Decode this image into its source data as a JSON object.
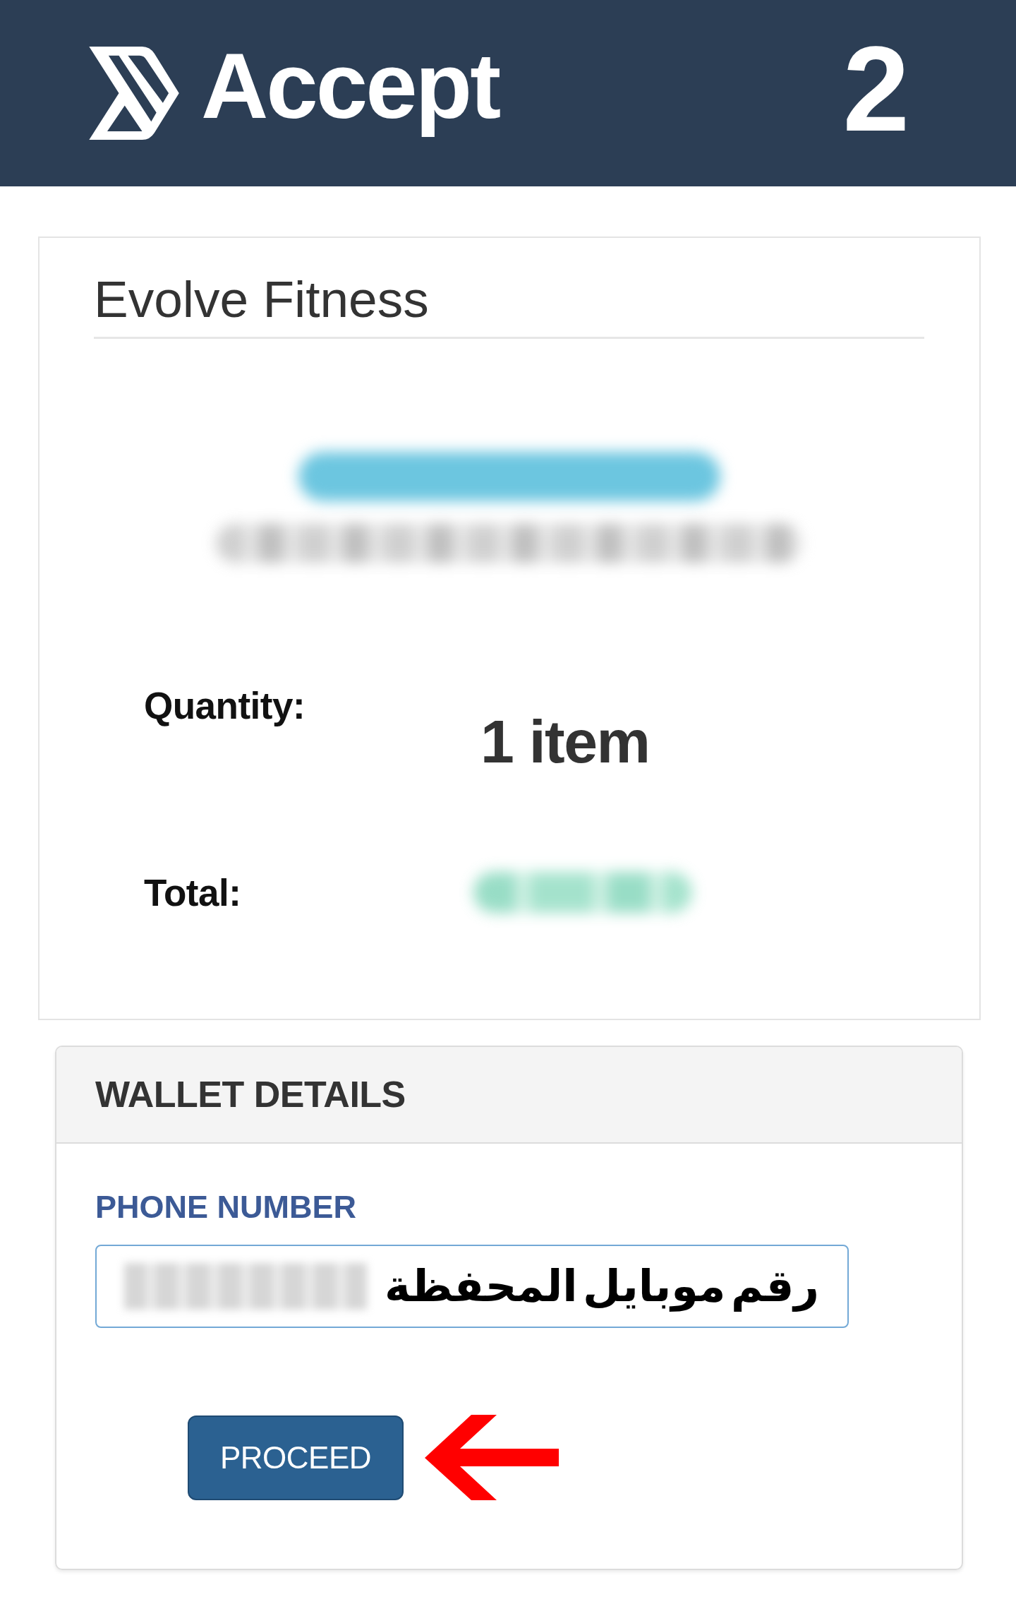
{
  "header": {
    "logo_text": "Accept",
    "step": "2"
  },
  "order": {
    "merchant": "Evolve Fitness",
    "quantity": {
      "label": "Quantity:",
      "value": "1 item"
    },
    "total": {
      "label": "Total:"
    }
  },
  "wallet": {
    "title": "WALLET DETAILS",
    "phone": {
      "label": "PHONE NUMBER",
      "annotation": "رقم موبايل المحفظة"
    },
    "button": "PROCEED"
  }
}
